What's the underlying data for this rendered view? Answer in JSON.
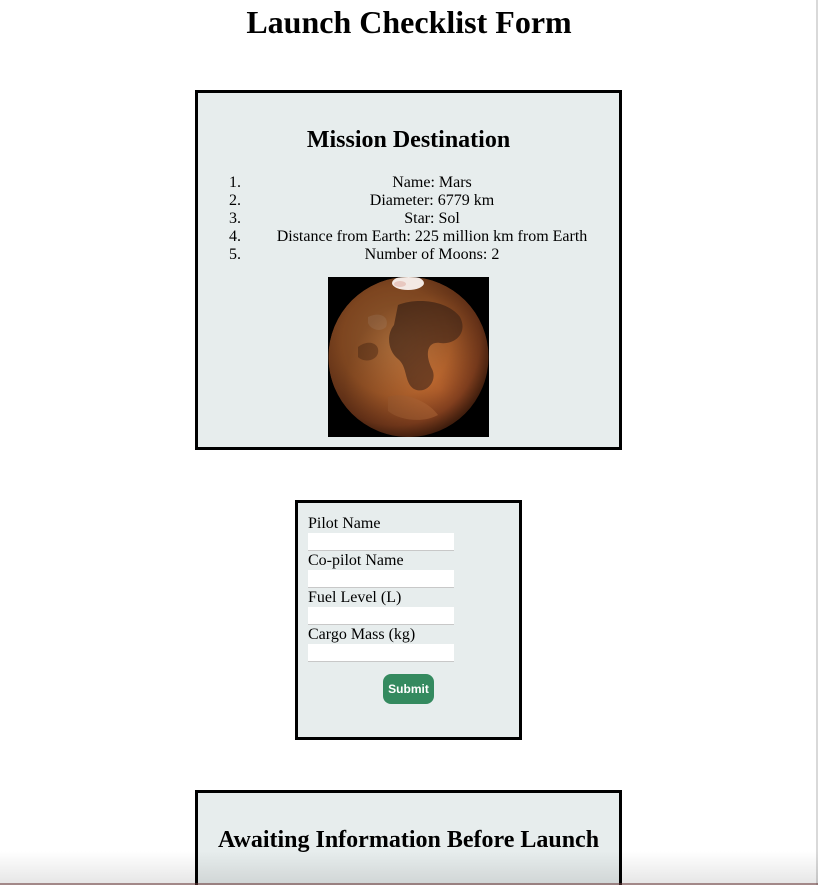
{
  "page": {
    "title": "Launch Checklist Form"
  },
  "destination": {
    "heading": "Mission Destination",
    "items": [
      {
        "num": "1.",
        "text": "Name: Mars"
      },
      {
        "num": "2.",
        "text": "Diameter: 6779 km"
      },
      {
        "num": "3.",
        "text": "Star: Sol"
      },
      {
        "num": "4.",
        "text": "Distance from Earth: 225 million km from Earth"
      },
      {
        "num": "5.",
        "text": "Number of Moons: 2"
      }
    ],
    "image": {
      "depicts": "planet Mars"
    }
  },
  "form": {
    "fields": [
      {
        "label": "Pilot Name",
        "value": ""
      },
      {
        "label": "Co-pilot Name",
        "value": ""
      },
      {
        "label": "Fuel Level (L)",
        "value": ""
      },
      {
        "label": "Cargo Mass (kg)",
        "value": ""
      }
    ],
    "submit_label": "Submit"
  },
  "status": {
    "heading": "Awaiting Information Before Launch"
  },
  "colors": {
    "panel_bg": "#e7eded",
    "submit_bg": "#348a5f",
    "border": "#000000"
  }
}
